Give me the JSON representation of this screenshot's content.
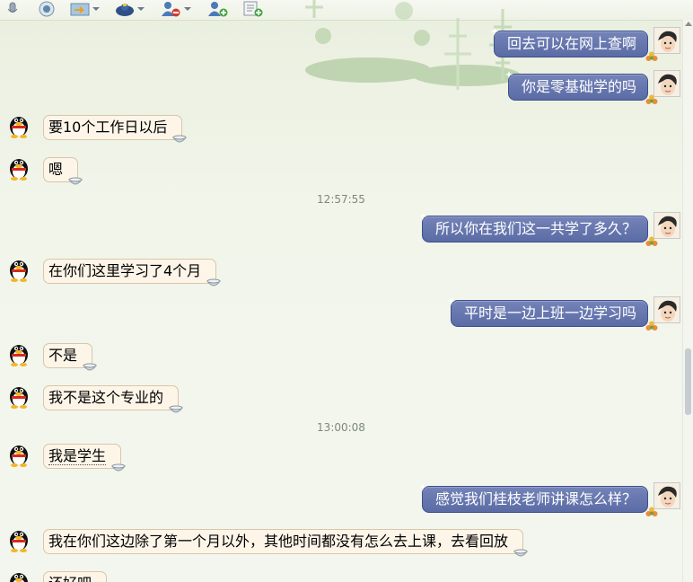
{
  "toolbar": {
    "icons": [
      "microphone-icon",
      "camera-icon",
      "send-file-icon",
      "security-icon",
      "remove-contact-icon",
      "add-contact-icon",
      "add-note-icon"
    ]
  },
  "messages": [
    {
      "side": "right",
      "text": "回去可以在网上查啊"
    },
    {
      "side": "right",
      "text": "你是零基础学的吗"
    },
    {
      "side": "left",
      "text": "要10个工作日以后"
    },
    {
      "side": "left",
      "text": "嗯"
    },
    {
      "type": "time",
      "text": "12:57:55"
    },
    {
      "side": "right",
      "text": "所以你在我们这一共学了多久？"
    },
    {
      "side": "left",
      "text": "在你们这里学习了4个月"
    },
    {
      "side": "right",
      "text": "平时是一边上班一边学习吗"
    },
    {
      "side": "left",
      "text": "不是"
    },
    {
      "side": "left",
      "text": "我不是这个专业的"
    },
    {
      "type": "time",
      "text": "13:00:08"
    },
    {
      "side": "left",
      "text": "我是学生"
    },
    {
      "side": "right",
      "text": "感觉我们桂枝老师讲课怎么样？"
    },
    {
      "side": "left",
      "text": "我在你们这边除了第一个月以外，其他时间都没有怎么去上课，去看回放"
    },
    {
      "side": "left",
      "text": "还好吧"
    }
  ],
  "colors": {
    "right_bubble": "#6272ad",
    "left_bubble": "#fdf5e8",
    "background": "#f2f5ea"
  }
}
